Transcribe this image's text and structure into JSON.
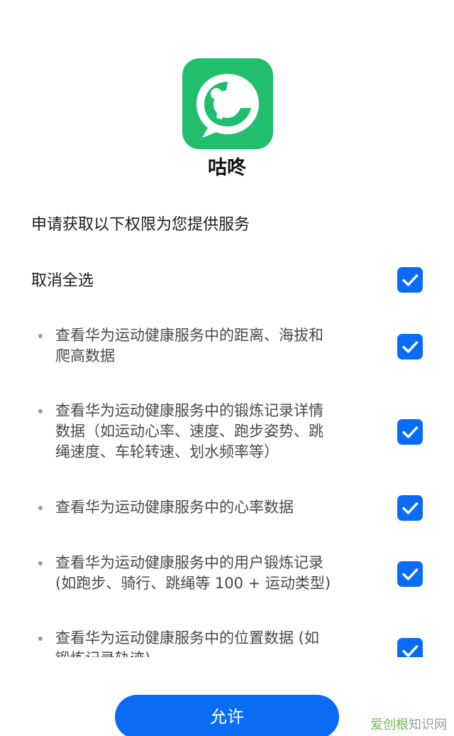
{
  "app": {
    "name": "咕咚",
    "icon": "gudong-logo-icon",
    "brand_color": "#21be6e"
  },
  "request_title": "申请获取以下权限为您提供服务",
  "select_all": {
    "label": "取消全选",
    "checked": true
  },
  "accent_color": "#0a6cf5",
  "permissions": [
    {
      "lines": [
        "查看华为运动健康服务中的距离、海拔和",
        "爬高数据"
      ],
      "checked": true
    },
    {
      "lines": [
        "查看华为运动健康服务中的锻炼记录详情",
        "数据（如运动心率、速度、跑步姿势、跳",
        "绳速度、车轮转速、划水频率等）"
      ],
      "checked": true
    },
    {
      "lines": [
        "查看华为运动健康服务中的心率数据"
      ],
      "checked": true
    },
    {
      "lines": [
        "查看华为运动健康服务中的用户锻炼记录",
        "(如跑步、骑行、跳绳等 100 + 运动类型)"
      ],
      "checked": true
    },
    {
      "lines": [
        "查看华为运动健康服务中的位置数据 (如",
        "锻炼记录轨迹)"
      ],
      "checked": true
    }
  ],
  "allow_button": {
    "label": "允许"
  },
  "watermark": {
    "part1": "爱创根",
    "part2": "知识网"
  }
}
